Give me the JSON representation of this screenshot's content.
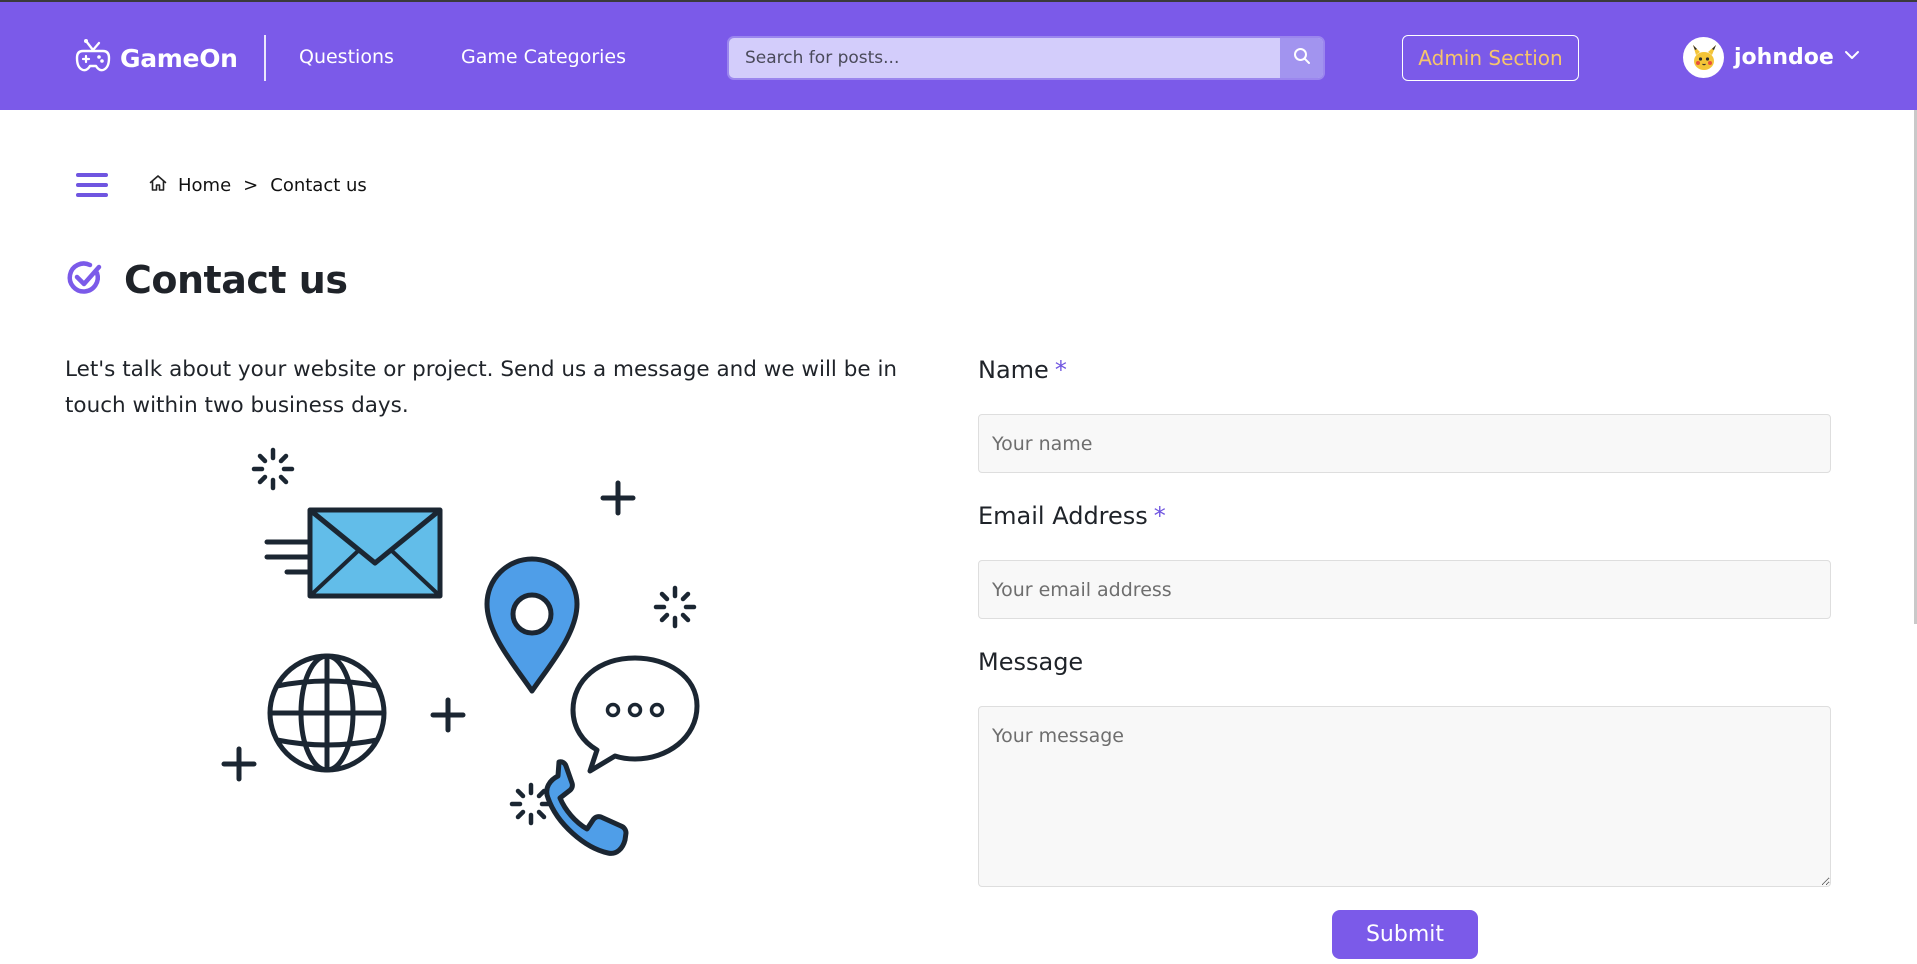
{
  "header": {
    "logo_text": "GameOn",
    "nav": [
      {
        "label": "Questions"
      },
      {
        "label": "Game Categories"
      }
    ],
    "search": {
      "placeholder": "Search for posts..."
    },
    "admin_label": "Admin Section",
    "user": {
      "name": "johndoe"
    }
  },
  "breadcrumb": {
    "home": "Home",
    "separator": ">",
    "current": "Contact us"
  },
  "page": {
    "title": "Contact us",
    "intro": "Let's talk about your website or project. Send us a message and we will be in touch within two business days."
  },
  "form": {
    "name": {
      "label": "Name",
      "required_mark": "*",
      "placeholder": "Your name"
    },
    "email": {
      "label": "Email Address",
      "required_mark": "*",
      "placeholder": "Your email address"
    },
    "message": {
      "label": "Message",
      "placeholder": "Your message"
    },
    "submit_label": "Submit"
  },
  "theme": {
    "primary": "#7b5ae9",
    "admin_accent": "#f6c56b",
    "illustration_blue": "#4f9ee8",
    "illustration_light_blue": "#62bde9",
    "outline_dark": "#1b2632"
  },
  "icons": {
    "logo": "gamepad-icon",
    "search": "search-icon",
    "user_menu": "chevron-down-icon",
    "menu": "hamburger-menu-icon",
    "home": "home-icon",
    "title": "check-circle-icon"
  }
}
